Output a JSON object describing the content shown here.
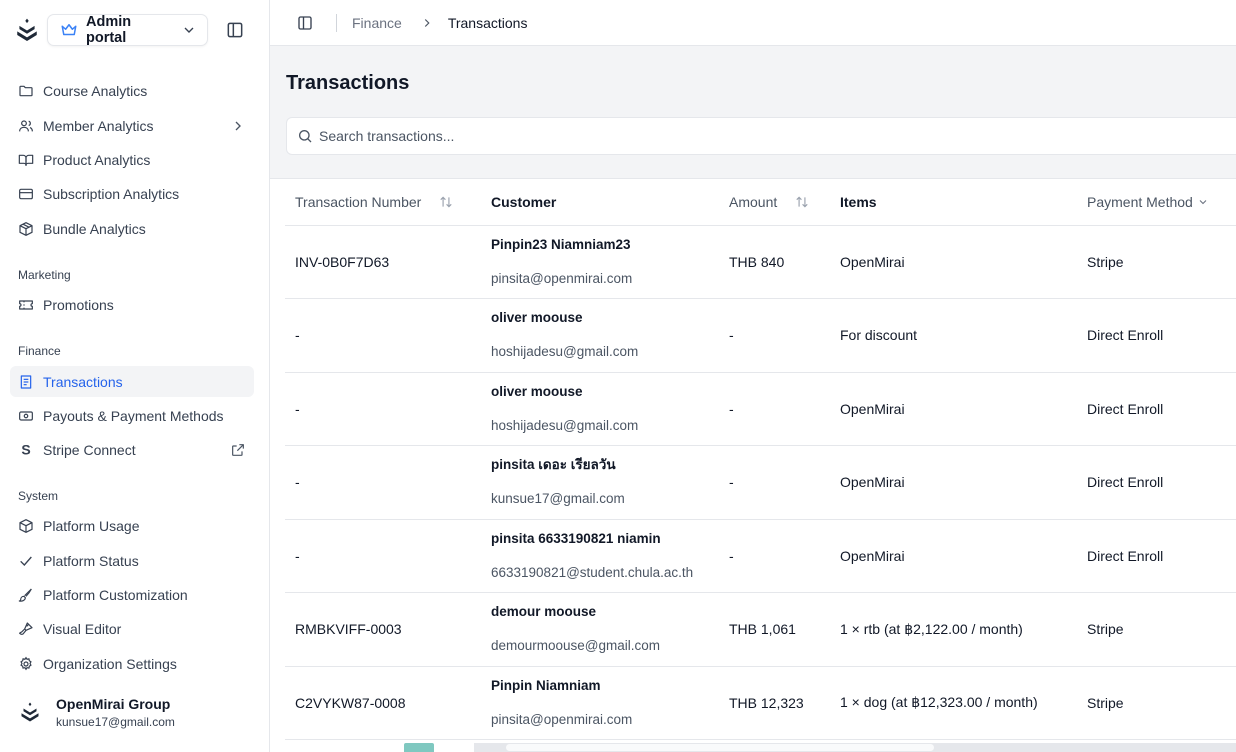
{
  "sidebar": {
    "portal_label": "Admin portal",
    "nav_top": [
      {
        "label": "Course Analytics",
        "icon": "folder-icon"
      },
      {
        "label": "Member Analytics",
        "icon": "users-icon"
      },
      {
        "label": "Product Analytics",
        "icon": "book-open-icon"
      },
      {
        "label": "Subscription Analytics",
        "icon": "credit-card-icon"
      },
      {
        "label": "Bundle Analytics",
        "icon": "package-icon"
      }
    ],
    "marketing_label": "Marketing",
    "marketing": [
      {
        "label": "Promotions",
        "icon": "ticket-icon"
      }
    ],
    "finance_label": "Finance",
    "finance": [
      {
        "label": "Transactions",
        "icon": "receipt-icon"
      },
      {
        "label": "Payouts & Payment Methods",
        "icon": "banknote-icon"
      },
      {
        "label": "Stripe Connect",
        "icon": "stripe-icon"
      }
    ],
    "system_label": "System",
    "system": [
      {
        "label": "Platform Usage",
        "icon": "box-icon"
      },
      {
        "label": "Platform Status",
        "icon": "check-icon"
      },
      {
        "label": "Platform Customization",
        "icon": "paintbrush-icon"
      },
      {
        "label": "Visual Editor",
        "icon": "brush-icon"
      },
      {
        "label": "Organization Settings",
        "icon": "settings-icon"
      }
    ],
    "org": {
      "name": "OpenMirai Group",
      "email": "kunsue17@gmail.com"
    }
  },
  "breadcrumb": {
    "parent": "Finance",
    "current": "Transactions"
  },
  "page": {
    "title": "Transactions",
    "search_placeholder": "Search transactions..."
  },
  "table": {
    "headers": {
      "number": "Transaction Number",
      "customer": "Customer",
      "amount": "Amount",
      "items": "Items",
      "payment": "Payment Method"
    },
    "rows": [
      {
        "number": "INV-0B0F7D63",
        "name": "Pinpin23 Niamniam23",
        "email": "pinsita@openmirai.com",
        "amount": "THB 840",
        "items": "OpenMirai",
        "payment": "Stripe"
      },
      {
        "number": "-",
        "name": "oliver moouse",
        "email": "hoshijadesu@gmail.com",
        "amount": "-",
        "items": "For discount",
        "payment": "Direct Enroll"
      },
      {
        "number": "-",
        "name": "oliver moouse",
        "email": "hoshijadesu@gmail.com",
        "amount": "-",
        "items": "OpenMirai",
        "payment": "Direct Enroll"
      },
      {
        "number": "-",
        "name": "pinsita เดอะ เรียลวัน",
        "email": "kunsue17@gmail.com",
        "amount": "-",
        "items": "OpenMirai",
        "payment": "Direct Enroll"
      },
      {
        "number": "-",
        "name": "pinsita 6633190821 niamin",
        "email": "6633190821@student.chula.ac.th",
        "amount": "-",
        "items": "OpenMirai",
        "payment": "Direct Enroll"
      },
      {
        "number": "RMBKVIFF-0003",
        "name": "demour moouse",
        "email": "demourmoouse@gmail.com",
        "amount": "THB 1,061",
        "items": "1 × rtb (at ฿2,122.00 / month)",
        "payment": "Stripe"
      },
      {
        "number": "C2VYKW87-0008",
        "name": "Pinpin Niamniam",
        "email": "pinsita@openmirai.com",
        "amount": "THB 12,323",
        "items": "1 × dog (at ฿12,323.00 / month)",
        "payment": "Stripe"
      }
    ]
  },
  "colors": {
    "accent": "#2563eb",
    "crown": "#3b82f6",
    "active_bg": "#f3f4f6"
  }
}
